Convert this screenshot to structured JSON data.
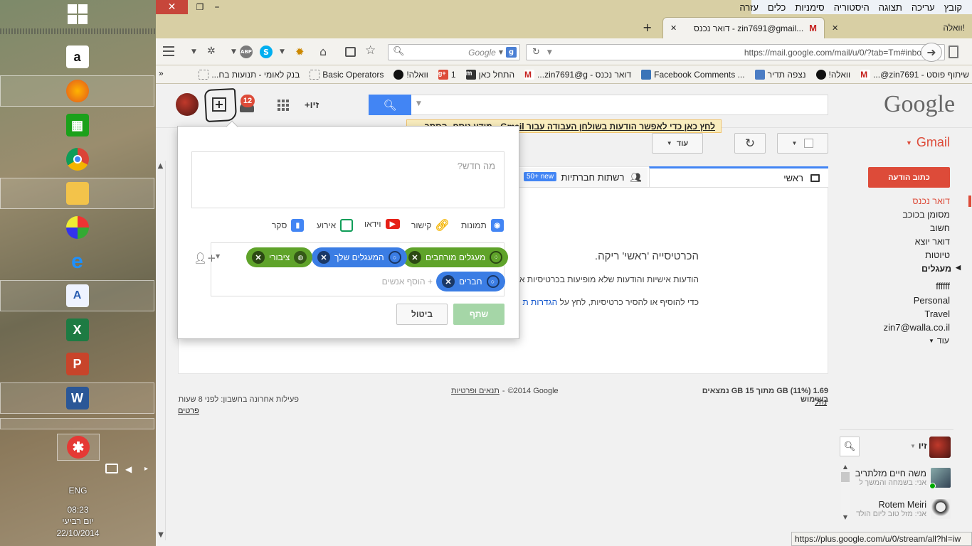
{
  "taskbar": {
    "lang": "ENG",
    "time": "08:23",
    "day": "יום רביעי",
    "date": "22/10/2014"
  },
  "menubar": [
    "קובץ",
    "עריכה",
    "תצוגה",
    "היסטוריה",
    "סימניות",
    "כלים",
    "עזרה"
  ],
  "tabs": [
    {
      "label": "דואר נכנס - zin7691@gmail...",
      "active": true
    },
    {
      "label": "וואלה!",
      "active": false
    }
  ],
  "navbar": {
    "url": "https://mail.google.com/mail/u/0/?tab=Tm#inbox",
    "search_placeholder": "Google"
  },
  "bookmarks": [
    "שיתוף פוסט - zin7691@...",
    "וואלה!",
    "נצפה תדיר",
    "Facebook Comments ...",
    "דואר נכנס - zin7691@g...",
    "התחל כאן",
    "1",
    "וואלה!",
    "Basic Operators",
    "בנק לאומי - תנועות בח..."
  ],
  "google": {
    "logo": "Google",
    "user_label": "+זיו",
    "notif_count": "12",
    "banner_text": "לחץ כאן כדי לאפשר הודעות בשולחן העבודה עבור Gmail.",
    "banner_more": "מידע נוסף",
    "banner_hide": "הסתר"
  },
  "gmail": {
    "title": "Gmail",
    "compose": "כתוב הודעה",
    "more_btn": "עוד",
    "nav": [
      "דואר נכנס",
      "מסומן בכוכב",
      "חשוב",
      "דואר יוצא",
      "טיוטות"
    ],
    "circles_label": "מעגלים",
    "labels": [
      "ffffff",
      "Personal",
      "Travel",
      "zin7@walla.co.il"
    ],
    "more_label": "עוד",
    "tab_primary": "ראשי",
    "tab_social": "רשתות חברתיות",
    "tab_social_badge": "50+ new",
    "empty_title": "הכרטיסייה 'ראשי' ריקה.",
    "empty_line1": "הודעות אישיות והודעות שלא מופיעות בכרטיסיות א",
    "empty_line2_a": "כדי להוסיף או להסיר כרטיסיות, לחץ על",
    "empty_line2_link": "הגדרות ת",
    "storage": "1.69 GB (11%) מתוך 15 GB נמצאים בשימוש",
    "manage": "נהל",
    "copyright": "©2014 Google",
    "terms": "תנאים ופרטיות",
    "activity": "פעילות אחרונה בחשבון: לפני 8 שעות",
    "details": "פרטים"
  },
  "share": {
    "placeholder": "מה חדש?",
    "options": [
      "תמונות",
      "קישור",
      "וידאו",
      "אירוע",
      "סקר"
    ],
    "chips": [
      "מעגלים מורחבים",
      "המעגלים שלך",
      "ציבורי",
      "חברים"
    ],
    "add_people": "+ הוסף אנשים",
    "share_btn": "שתף",
    "cancel_btn": "ביטול"
  },
  "chat": {
    "me": "זיו",
    "contacts": [
      {
        "name": "משה חיים מזלתריב",
        "status": "אני: בשמחה והמשך ל"
      },
      {
        "name": "Rotem Meiri",
        "status": "אני: מזל טוב ליום הולד"
      }
    ]
  },
  "statusbar": "https://plus.google.com/u/0/stream/all?hl=iw",
  "colors": {
    "compose_red": "#dd4b39",
    "google_blue": "#4285f4",
    "chip_green": "#5fa32a",
    "chip_blue": "#3b7de4"
  }
}
